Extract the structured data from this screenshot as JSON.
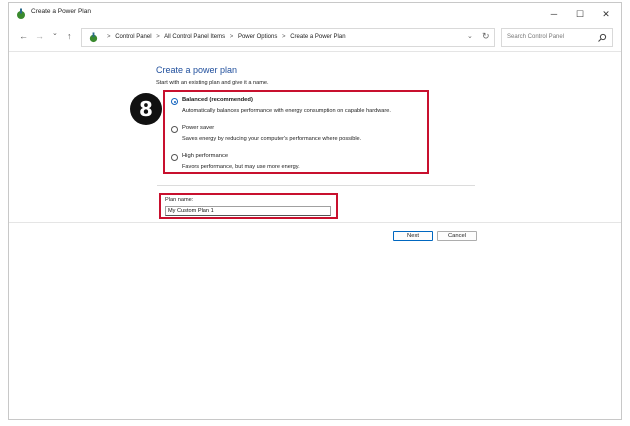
{
  "window": {
    "title": "Create a Power Plan",
    "controls": {
      "minimize": "─",
      "maximize": "☐",
      "close": "✕"
    }
  },
  "nav": {
    "back": "←",
    "forward": "→",
    "recent": "⌄",
    "up": "↑",
    "breadcrumbs": [
      "Control Panel",
      "All Control Panel Items",
      "Power Options",
      "Create a Power Plan"
    ],
    "separator": ">",
    "dropdown": "⌄",
    "refresh": "↻",
    "search_placeholder": "Search Control Panel"
  },
  "content": {
    "heading": "Create a power plan",
    "subheading": "Start with an existing plan and give it a name.",
    "plans": [
      {
        "name": "Balanced (recommended)",
        "description": "Automatically balances performance with energy consumption on capable hardware.",
        "selected": true
      },
      {
        "name": "Power saver",
        "description": "Saves energy by reducing your computer's performance where possible.",
        "selected": false
      },
      {
        "name": "High performance",
        "description": "Favors performance, but may use more energy.",
        "selected": false
      }
    ],
    "plan_name_label": "Plan name:",
    "plan_name_value": "My Custom Plan 1",
    "next_label": "Next",
    "cancel_label": "Cancel"
  },
  "annotation": {
    "step": "8",
    "highlight_color": "#c8102e"
  }
}
